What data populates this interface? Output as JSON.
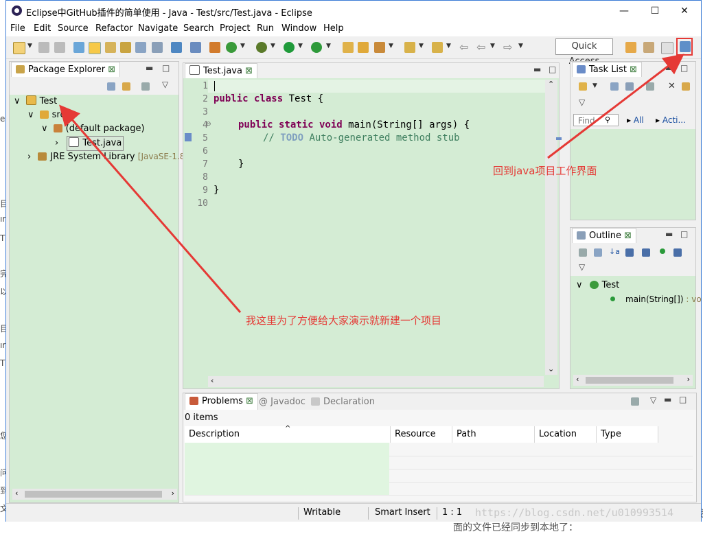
{
  "window": {
    "title": "Eclipse中GitHub插件的简单使用 - Java - Test/src/Test.java - Eclipse",
    "min_label": "—",
    "max_label": "☐",
    "close_label": "✕"
  },
  "menu": [
    "File",
    "Edit",
    "Source",
    "Refactor",
    "Navigate",
    "Search",
    "Project",
    "Run",
    "Window",
    "Help"
  ],
  "toolbar": {
    "quick_access_placeholder": "Quick Access"
  },
  "package_explorer": {
    "tab_label": "Package Explorer",
    "tree": [
      {
        "label": "Test",
        "toggle": "∨"
      },
      {
        "label": "src",
        "toggle": "∨"
      },
      {
        "label": "(default package)",
        "toggle": "∨"
      },
      {
        "label": "Test.java",
        "toggle": "›"
      },
      {
        "label": "JRE System Library",
        "suffix": "[JavaSE-1.8]",
        "toggle": "›"
      }
    ]
  },
  "editor": {
    "tab_label": "Test.java",
    "line_numbers": [
      "1",
      "2",
      "3",
      "4",
      "5",
      "6",
      "7",
      "8",
      "9",
      "10"
    ],
    "code": {
      "l2_kw": "public class",
      "l2_rest": " Test {",
      "l4_kw": "public static void",
      "l4_rest": " main(String[] args) {",
      "l5_slashes": "// ",
      "l5_todo": "TODO",
      "l5_text": " Auto-generated method stub",
      "l7": "}",
      "l9": "}"
    }
  },
  "task_list": {
    "tab_label": "Task List",
    "find_placeholder": "Find",
    "all_label": "All",
    "activate_label": "Acti..."
  },
  "outline": {
    "tab_label": "Outline",
    "class_name": "Test",
    "method": "main(String[])",
    "method_suffix": ": vo"
  },
  "bottom": {
    "tabs": [
      "Problems",
      "Javadoc",
      "Declaration"
    ],
    "items_count": "0 items",
    "columns": [
      "Description",
      "Resource",
      "Path",
      "Location",
      "Type"
    ]
  },
  "status": {
    "writable": "Writable",
    "insert_mode": "Smart Insert",
    "position": "1 : 1"
  },
  "annotations": {
    "new_project_note": "我这里为了方便给大家演示就新建一个项目",
    "back_to_java_note": "回到java项目工作界面"
  },
  "watermark": "https://blog.csdn.net/u010993514",
  "background_text": {
    "side": [
      "e",
      "目",
      "ır",
      "T",
      "完",
      "以",
      "目",
      "ır",
      "T",
      "您",
      "问",
      "到",
      "文"
    ],
    "right_edge": "我",
    "bottom_cut": "面的文件已经同步到本地了："
  },
  "colors": {
    "editor_bg": "#d4ecd4",
    "annotation_red": "#e53935",
    "keyword": "#7f0055",
    "comment": "#3f7f5f"
  }
}
